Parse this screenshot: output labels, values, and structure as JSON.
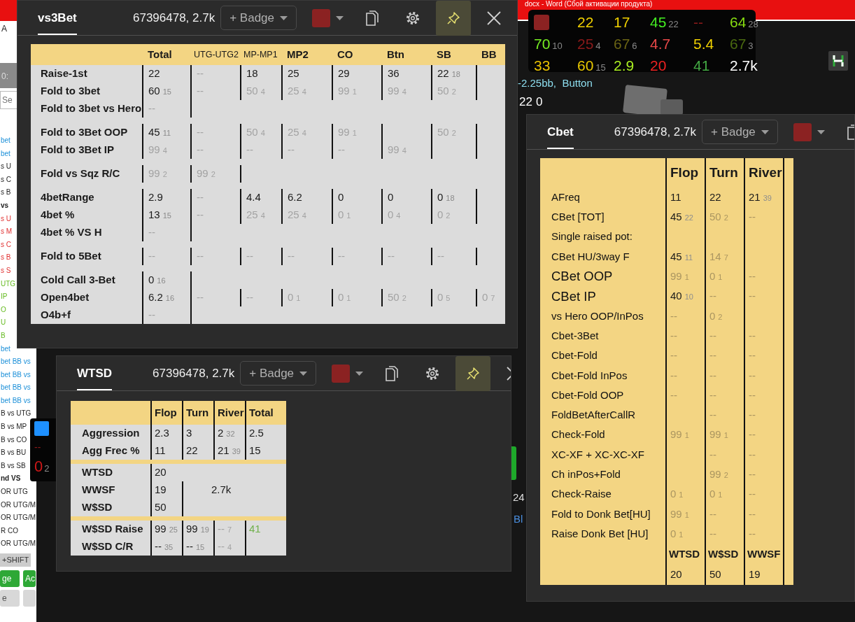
{
  "desktop": {
    "word_title": "docx - Word (Сбой активации продукта)"
  },
  "side_panel": {
    "header_letter": "A",
    "time": "0:",
    "search_placeholder": "Se",
    "lines": [
      {
        "text": "bet",
        "kind": "link",
        "bold": false
      },
      {
        "text": "bet",
        "kind": "link",
        "bold": false
      },
      {
        "text": "s U",
        "kind": "plain",
        "bold": false
      },
      {
        "text": "s C",
        "kind": "plain",
        "bold": false
      },
      {
        "text": "s B",
        "kind": "plain",
        "bold": false
      },
      {
        "text": "vs",
        "kind": "plain",
        "bold": true
      },
      {
        "text": "s U",
        "kind": "alert",
        "bold": false
      },
      {
        "text": "s M",
        "kind": "alert",
        "bold": false
      },
      {
        "text": "s C",
        "kind": "alert",
        "bold": false
      },
      {
        "text": "s B",
        "kind": "alert",
        "bold": false
      },
      {
        "text": "s S",
        "kind": "alert",
        "bold": false
      },
      {
        "text": "UTG",
        "kind": "good",
        "bold": false
      },
      {
        "text": "IP",
        "kind": "good",
        "bold": false
      },
      {
        "text": "O",
        "kind": "good",
        "bold": false
      },
      {
        "text": "U",
        "kind": "good",
        "bold": false
      },
      {
        "text": "B",
        "kind": "good",
        "bold": false
      },
      {
        "text": "bet",
        "kind": "link",
        "bold": false
      },
      {
        "text": "bet BB vs",
        "kind": "link",
        "bold": false
      },
      {
        "text": "bet BB vs",
        "kind": "link",
        "bold": false
      },
      {
        "text": "bet BB vs",
        "kind": "link",
        "bold": false
      },
      {
        "text": "bet BB vs",
        "kind": "link",
        "bold": false
      },
      {
        "text": "B vs UTG",
        "kind": "plain",
        "bold": false
      },
      {
        "text": "B vs MP",
        "kind": "plain",
        "bold": false
      },
      {
        "text": "B vs CO",
        "kind": "plain",
        "bold": false
      },
      {
        "text": "B vs BU",
        "kind": "plain",
        "bold": false
      },
      {
        "text": "B vs SB",
        "kind": "plain",
        "bold": false
      },
      {
        "text": "nd VS",
        "kind": "plain",
        "bold": true
      },
      {
        "text": "OR UTG",
        "kind": "plain",
        "bold": false
      },
      {
        "text": "OR UTG/M",
        "kind": "plain",
        "bold": false
      },
      {
        "text": "OR UTG/M",
        "kind": "plain",
        "bold": false
      },
      {
        "text": "R CO",
        "kind": "plain",
        "bold": false
      },
      {
        "text": "OR UTG/M",
        "kind": "plain",
        "bold": false
      }
    ],
    "shift_label": "+SHIFT",
    "buttons": [
      {
        "label": "ge",
        "kind": "green"
      },
      {
        "label": "Ac",
        "kind": "green"
      },
      {
        "label": "e",
        "kind": "grey"
      },
      {
        "kind": "grey"
      }
    ]
  },
  "table_view": {
    "bet_line": "-2.25bb,  Button",
    "stack": "22",
    "pot": "0",
    "edge_texts": [
      "24",
      "Bl"
    ]
  },
  "hud": {
    "cells": [
      {
        "v": "22",
        "color": "#f0d000"
      },
      {
        "v": "17",
        "color": "#f0d000"
      },
      {
        "v": "45",
        "n": "22",
        "color": "#44ee22"
      },
      {
        "v": "--",
        "color": "#8b1a1a"
      },
      {
        "v": "64",
        "n": "28",
        "color": "#88dd11"
      },
      {
        "v": "70",
        "n": "10",
        "color": "#77ee22"
      },
      {
        "v": "25",
        "n": "4",
        "color": "#8b1a1a"
      },
      {
        "v": "67",
        "n": "6",
        "color": "#6b6414"
      },
      {
        "v": "4.7",
        "color": "#e84848"
      },
      {
        "v": "5.4",
        "color": "#f0d000"
      },
      {
        "v": "67",
        "n": "3",
        "color": "#4a6a10"
      },
      {
        "v": "33",
        "color": "#e8c000"
      },
      {
        "v": "60",
        "n": "15",
        "color": "#e8c800"
      },
      {
        "v": "2.9",
        "color": "#aaee22"
      },
      {
        "v": "20",
        "color": "#ee2222"
      },
      {
        "v": "41",
        "color": "#44aa44"
      },
      {
        "v": "2.7k",
        "color": "#ffffff"
      }
    ]
  },
  "mini_hud": {
    "top": "--",
    "value": "0",
    "count": "2"
  },
  "windows": [
    {
      "title": "vs3Bet",
      "player": "67396478, 2.7k",
      "badge": "+ Badge",
      "color": "#8b2222",
      "pinned": true,
      "tools": [
        {
          "kind": "copy"
        },
        {
          "kind": "settings"
        },
        {
          "kind": "pin"
        },
        {
          "kind": "close"
        }
      ],
      "table": {
        "kind": "grid",
        "columns": [
          {
            "label": "Total",
            "compact": false
          },
          {
            "label": "UTG-UTG2",
            "compact": true
          },
          {
            "label": "MP-MP1",
            "compact": true
          },
          {
            "label": "MP2",
            "compact": false
          },
          {
            "label": "CO",
            "compact": false
          },
          {
            "label": "Btn",
            "compact": false
          },
          {
            "label": "SB",
            "compact": false
          },
          {
            "label": "BB",
            "compact": false
          }
        ],
        "groups": [
          [
            {
              "label": "Raise-1st",
              "cells": [
                {
                  "kind": "value",
                  "v": "22"
                },
                {
                  "kind": "faded",
                  "v": "--"
                },
                {
                  "kind": "value",
                  "v": "18"
                },
                {
                  "kind": "value",
                  "v": "25"
                },
                {
                  "kind": "value",
                  "v": "29"
                },
                {
                  "kind": "value",
                  "v": "36"
                },
                {
                  "kind": "value",
                  "v": "22",
                  "n": "18"
                },
                {
                  "kind": "blank"
                }
              ]
            },
            {
              "label": "Fold to 3bet",
              "cells": [
                {
                  "kind": "value",
                  "v": "60",
                  "n": "15"
                },
                {
                  "kind": "faded",
                  "v": "--"
                },
                {
                  "kind": "faded",
                  "v": "50",
                  "n": "4"
                },
                {
                  "kind": "faded",
                  "v": "25",
                  "n": "4"
                },
                {
                  "kind": "faded",
                  "v": "99",
                  "n": "1"
                },
                {
                  "kind": "faded",
                  "v": "99",
                  "n": "4"
                },
                {
                  "kind": "faded",
                  "v": "50",
                  "n": "2"
                },
                {
                  "kind": "blank"
                }
              ]
            },
            {
              "label": "Fold to 3bet vs Hero",
              "cells": [
                {
                  "kind": "faded",
                  "v": "--"
                },
                {
                  "kind": "blank"
                },
                null,
                null,
                null,
                null,
                null,
                null
              ]
            }
          ],
          [
            {
              "label": "Fold to 3Bet OOP",
              "cells": [
                {
                  "kind": "value",
                  "v": "45",
                  "n": "11"
                },
                {
                  "kind": "faded",
                  "v": "--"
                },
                {
                  "kind": "faded",
                  "v": "50",
                  "n": "4"
                },
                {
                  "kind": "faded",
                  "v": "25",
                  "n": "4"
                },
                {
                  "kind": "faded",
                  "v": "99",
                  "n": "1"
                },
                {
                  "kind": "blank"
                },
                {
                  "kind": "faded",
                  "v": "50",
                  "n": "2"
                },
                {
                  "kind": "blank"
                }
              ]
            },
            {
              "label": "Fold to 3Bet IP",
              "cells": [
                {
                  "kind": "faded",
                  "v": "99",
                  "n": "4"
                },
                {
                  "kind": "faded",
                  "v": "--"
                },
                {
                  "kind": "faded",
                  "v": "--"
                },
                {
                  "kind": "faded",
                  "v": "--"
                },
                {
                  "kind": "faded",
                  "v": "--"
                },
                {
                  "kind": "faded",
                  "v": "99",
                  "n": "4"
                },
                {
                  "kind": "blank"
                },
                {
                  "kind": "blank"
                }
              ]
            }
          ],
          [
            {
              "label": "Fold vs Sqz R/C",
              "cells": [
                {
                  "kind": "faded",
                  "v": "99",
                  "n": "2"
                },
                {
                  "kind": "faded",
                  "v": "99",
                  "n": "2"
                },
                {
                  "kind": "blank"
                },
                null,
                null,
                null,
                null,
                null
              ]
            }
          ],
          [
            {
              "label": "4betRange",
              "cells": [
                {
                  "kind": "value",
                  "v": "2.9"
                },
                {
                  "kind": "faded",
                  "v": "--"
                },
                {
                  "kind": "value",
                  "v": "4.4"
                },
                {
                  "kind": "value",
                  "v": "6.2"
                },
                {
                  "kind": "value",
                  "v": "0"
                },
                {
                  "kind": "value",
                  "v": "0"
                },
                {
                  "kind": "value",
                  "v": "0",
                  "n": "18"
                },
                {
                  "kind": "blank"
                }
              ]
            },
            {
              "label": "4bet %",
              "cells": [
                {
                  "kind": "value",
                  "v": "13",
                  "n": "15"
                },
                {
                  "kind": "faded",
                  "v": "--"
                },
                {
                  "kind": "faded",
                  "v": "25",
                  "n": "4"
                },
                {
                  "kind": "faded",
                  "v": "25",
                  "n": "4"
                },
                {
                  "kind": "faded",
                  "v": "0",
                  "n": "1"
                },
                {
                  "kind": "faded",
                  "v": "0",
                  "n": "4"
                },
                {
                  "kind": "faded",
                  "v": "0",
                  "n": "2"
                },
                {
                  "kind": "blank"
                }
              ]
            },
            {
              "label": "4bet % VS H",
              "cells": [
                {
                  "kind": "faded",
                  "v": "--"
                },
                {
                  "kind": "blank"
                },
                null,
                null,
                null,
                null,
                null,
                null
              ]
            }
          ],
          [
            {
              "label": "Fold to 5Bet",
              "cells": [
                {
                  "kind": "faded",
                  "v": "--"
                },
                {
                  "kind": "faded",
                  "v": "--"
                },
                {
                  "kind": "faded",
                  "v": "--"
                },
                {
                  "kind": "faded",
                  "v": "--"
                },
                {
                  "kind": "faded",
                  "v": "--"
                },
                {
                  "kind": "faded",
                  "v": "--"
                },
                {
                  "kind": "faded",
                  "v": "--"
                },
                {
                  "kind": "blank"
                }
              ]
            }
          ],
          [
            {
              "label": "Cold Call 3-Bet",
              "cells": [
                {
                  "kind": "value",
                  "v": "0",
                  "n": "16"
                },
                {
                  "kind": "blank"
                },
                null,
                null,
                null,
                null,
                null,
                null
              ]
            },
            {
              "label": "Open4bet",
              "cells": [
                {
                  "kind": "value",
                  "v": "6.2",
                  "n": "16"
                },
                {
                  "kind": "faded",
                  "v": "--"
                },
                {
                  "kind": "faded",
                  "v": "--"
                },
                {
                  "kind": "faded",
                  "v": "0",
                  "n": "1"
                },
                {
                  "kind": "faded",
                  "v": "0",
                  "n": "1"
                },
                {
                  "kind": "faded",
                  "v": "50",
                  "n": "2"
                },
                {
                  "kind": "faded",
                  "v": "0",
                  "n": "5"
                },
                {
                  "kind": "faded",
                  "v": "0",
                  "n": "7"
                }
              ]
            },
            {
              "label": "O4b+f",
              "cells": [
                {
                  "kind": "faded",
                  "v": "--"
                },
                {
                  "kind": "blank"
                },
                null,
                null,
                null,
                null,
                null,
                null
              ]
            }
          ]
        ]
      }
    },
    {
      "title": "WTSD",
      "player": "67396478, 2.7k",
      "badge": "+ Badge",
      "color": "#8b2222",
      "pinned": true,
      "tools": [
        {
          "kind": "copy"
        },
        {
          "kind": "settings"
        },
        {
          "kind": "pin"
        },
        {
          "kind": "close"
        }
      ],
      "table": {
        "kind": "street",
        "columns": [
          {
            "label": "Flop"
          },
          {
            "label": "Turn"
          },
          {
            "label": "River"
          },
          {
            "label": "Total"
          }
        ],
        "groups": [
          [
            {
              "label": "Aggression",
              "cells": [
                {
                  "kind": "value",
                  "v": "2.3"
                },
                {
                  "kind": "value",
                  "v": "3"
                },
                {
                  "kind": "value",
                  "v": "2",
                  "n": "32"
                },
                {
                  "kind": "value",
                  "v": "2.5"
                }
              ]
            },
            {
              "label": "Agg Frec %",
              "cells": [
                {
                  "kind": "value",
                  "v": "11"
                },
                {
                  "kind": "value",
                  "v": "22"
                },
                {
                  "kind": "value",
                  "v": "21",
                  "n": "39"
                },
                {
                  "kind": "value",
                  "v": "15"
                }
              ]
            }
          ],
          [
            {
              "label": "WTSD",
              "cells": [
                {
                  "kind": "value",
                  "v": "20"
                },
                null,
                null,
                null
              ]
            },
            {
              "label": "WWSF",
              "cells": [
                {
                  "kind": "value",
                  "v": "19"
                },
                {
                  "kind": "summary",
                  "v": "2.7k"
                }
              ]
            },
            {
              "label": "W$SD",
              "cells": [
                {
                  "kind": "value",
                  "v": "50"
                },
                {
                  "kind": "continued"
                }
              ]
            }
          ],
          [
            {
              "label": "W$SD Raise",
              "cells": [
                {
                  "kind": "value",
                  "v": "99",
                  "n": "25"
                },
                {
                  "kind": "value",
                  "v": "99",
                  "n": "19"
                },
                {
                  "kind": "faded",
                  "v": "--",
                  "n": "7"
                },
                {
                  "kind": "value",
                  "v": "41",
                  "color": "#6fb04a"
                }
              ]
            },
            {
              "label": "W$SD C/R",
              "cells": [
                {
                  "kind": "value",
                  "v": "--",
                  "n": "35"
                },
                {
                  "kind": "value",
                  "v": "--",
                  "n": "15"
                },
                {
                  "kind": "faded",
                  "v": "--",
                  "n": "4"
                },
                {
                  "kind": "blank"
                }
              ]
            }
          ]
        ]
      }
    },
    {
      "title": "Cbet",
      "player": "67396478, 2.7k",
      "badge": "+ Badge",
      "color": "#8b2222",
      "tools": [
        {
          "kind": "copy"
        }
      ],
      "table": {
        "kind": "cbet",
        "columns": [
          {
            "label": "Flop"
          },
          {
            "label": "Turn"
          },
          {
            "label": "River"
          }
        ],
        "groups": [
          [
            {
              "label": "AFreq",
              "large": false,
              "cells": [
                {
                  "kind": "value",
                  "v": "11"
                },
                {
                  "kind": "value",
                  "v": "22"
                },
                {
                  "kind": "value",
                  "v": "21",
                  "n": "39"
                }
              ]
            },
            {
              "label": "CBet [TOT]",
              "large": false,
              "cells": [
                {
                  "kind": "value",
                  "v": "45",
                  "n": "22"
                },
                {
                  "kind": "faded",
                  "v": "50",
                  "n": "2"
                },
                {
                  "kind": "faded",
                  "v": "--"
                }
              ]
            },
            {
              "label": "Single raised pot:",
              "large": false,
              "cells": [
                {
                  "kind": "blank"
                },
                {
                  "kind": "blank"
                },
                {
                  "kind": "blank"
                }
              ]
            },
            {
              "label": "CBet HU/3way F",
              "large": false,
              "cells": [
                {
                  "kind": "value",
                  "v": "45",
                  "n": "11"
                },
                {
                  "kind": "faded",
                  "v": "14",
                  "n": "7"
                },
                {
                  "kind": "blank"
                }
              ]
            },
            {
              "label": "CBet OOP",
              "large": true,
              "cells": [
                {
                  "kind": "faded",
                  "v": "99",
                  "n": "1"
                },
                {
                  "kind": "faded",
                  "v": "0",
                  "n": "1"
                },
                {
                  "kind": "faded",
                  "v": "--"
                }
              ]
            },
            {
              "label": "CBet IP",
              "large": true,
              "cells": [
                {
                  "kind": "value",
                  "v": "40",
                  "n": "10"
                },
                {
                  "kind": "faded",
                  "v": "--"
                },
                {
                  "kind": "faded",
                  "v": "--"
                }
              ]
            },
            {
              "label": "vs Hero OOP/InPos",
              "large": false,
              "cells": [
                {
                  "kind": "faded",
                  "v": "--"
                },
                {
                  "kind": "faded",
                  "v": "0",
                  "n": "2"
                },
                {
                  "kind": "blank"
                }
              ]
            },
            {
              "label": "Cbet-3Bet",
              "large": false,
              "cells": [
                {
                  "kind": "faded",
                  "v": "--"
                },
                {
                  "kind": "faded",
                  "v": "--"
                },
                {
                  "kind": "faded",
                  "v": "--"
                }
              ]
            },
            {
              "label": "Cbet-Fold",
              "large": false,
              "cells": [
                {
                  "kind": "faded",
                  "v": "--"
                },
                {
                  "kind": "faded",
                  "v": "--"
                },
                {
                  "kind": "faded",
                  "v": "--"
                }
              ]
            },
            {
              "label": "Cbet-Fold InPos",
              "large": false,
              "cells": [
                {
                  "kind": "faded",
                  "v": "--"
                },
                {
                  "kind": "faded",
                  "v": "--"
                },
                {
                  "kind": "faded",
                  "v": "--"
                }
              ]
            },
            {
              "label": "Cbet-Fold OOP",
              "large": false,
              "cells": [
                {
                  "kind": "faded",
                  "v": "--"
                },
                {
                  "kind": "faded",
                  "v": "--"
                },
                {
                  "kind": "faded",
                  "v": "--"
                }
              ]
            },
            {
              "label": "FoldBetAfterCallR",
              "large": false,
              "cells": [
                {
                  "kind": "blank"
                },
                {
                  "kind": "faded",
                  "v": "--"
                },
                {
                  "kind": "faded",
                  "v": "--"
                }
              ]
            },
            {
              "label": "Check-Fold",
              "large": false,
              "cells": [
                {
                  "kind": "faded",
                  "v": "99",
                  "n": "1"
                },
                {
                  "kind": "faded",
                  "v": "99",
                  "n": "1"
                },
                {
                  "kind": "faded",
                  "v": "--"
                }
              ]
            },
            {
              "label": "XC-XF + XC-XC-XF",
              "large": false,
              "cells": [
                {
                  "kind": "blank"
                },
                {
                  "kind": "faded",
                  "v": "--"
                },
                {
                  "kind": "faded",
                  "v": "--"
                }
              ]
            },
            {
              "label": "Ch inPos+Fold",
              "large": false,
              "cells": [
                {
                  "kind": "blank"
                },
                {
                  "kind": "faded",
                  "v": "99",
                  "n": "2"
                },
                {
                  "kind": "faded",
                  "v": "--"
                }
              ]
            },
            {
              "label": "Check-Raise",
              "large": false,
              "cells": [
                {
                  "kind": "faded",
                  "v": "0",
                  "n": "1"
                },
                {
                  "kind": "faded",
                  "v": "0",
                  "n": "1"
                },
                {
                  "kind": "faded",
                  "v": "--"
                }
              ]
            },
            {
              "label": "Fold to Donk Bet[HU]",
              "large": false,
              "cells": [
                {
                  "kind": "faded",
                  "v": "99",
                  "n": "1"
                },
                {
                  "kind": "faded",
                  "v": "--"
                },
                {
                  "kind": "faded",
                  "v": "--"
                }
              ]
            },
            {
              "label": "Raise Donk Bet [HU]",
              "large": false,
              "cells": [
                {
                  "kind": "faded",
                  "v": "0",
                  "n": "1"
                },
                {
                  "kind": "faded",
                  "v": "--"
                },
                {
                  "kind": "faded",
                  "v": "--"
                }
              ]
            }
          ]
        ],
        "footer": {
          "labels": [
            "WTSD",
            "W$SD",
            "WWSF"
          ],
          "values": [
            "20",
            "50",
            "19"
          ]
        }
      }
    }
  ]
}
